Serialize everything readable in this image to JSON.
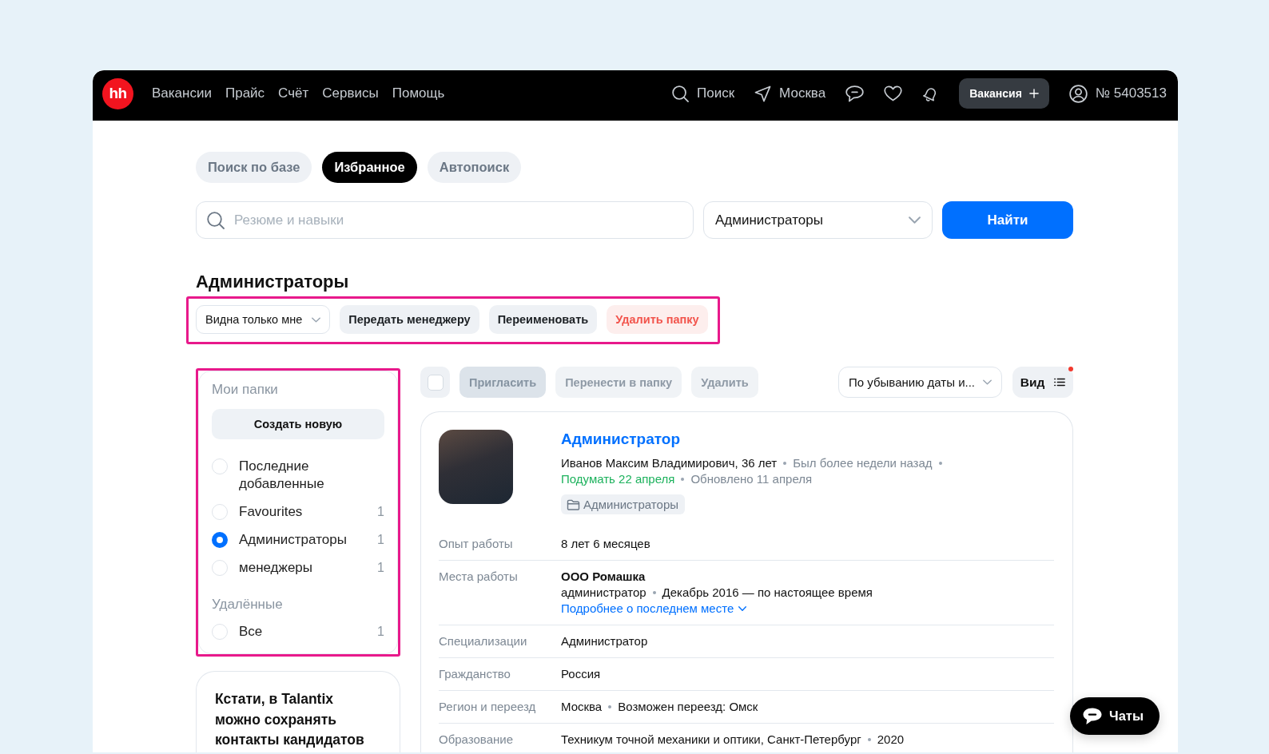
{
  "header": {
    "logo": "hh",
    "nav": [
      "Вакансии",
      "Прайс",
      "Счёт",
      "Сервисы",
      "Помощь"
    ],
    "search": "Поиск",
    "city": "Москва",
    "vacancy_button": "Вакансия",
    "account": "№ 5403513"
  },
  "tabs": [
    {
      "label": "Поиск по базе",
      "selected": false
    },
    {
      "label": "Избранное",
      "selected": true
    },
    {
      "label": "Автопоиск",
      "selected": false
    }
  ],
  "search": {
    "placeholder": "Резюме и навыки"
  },
  "folder_select": {
    "value": "Администраторы"
  },
  "find_button": "Найти",
  "folder_title": "Администраторы",
  "folder_actions": {
    "highlighted": true,
    "visibility": "Видна только мне",
    "buttons": [
      {
        "label": "Передать менеджеру",
        "kind": "default"
      },
      {
        "label": "Переименовать",
        "kind": "default"
      },
      {
        "label": "Удалить папку",
        "kind": "danger"
      }
    ]
  },
  "sidebar": {
    "highlighted": true,
    "my_folders_title": "Мои папки",
    "create_button": "Создать новую",
    "folders": [
      {
        "label": "Последние добавленные",
        "selected": false
      },
      {
        "label": "Favourites",
        "count": "1",
        "selected": false
      },
      {
        "label": "Администраторы",
        "count": "1",
        "selected": true
      },
      {
        "label": "менеджеры",
        "count": "1",
        "selected": false
      }
    ],
    "deleted_title": "Удалённые",
    "deleted": [
      {
        "label": "Все",
        "count": "1",
        "selected": false
      }
    ]
  },
  "promo": {
    "text": "Кстати, в Talantix можно сохранять контакты кандидатов"
  },
  "results": {
    "select_all": {
      "checked": false
    },
    "actions": [
      {
        "label": "Пригласить",
        "kind": "primary",
        "disabled": true
      },
      {
        "label": "Перенести в папку",
        "kind": "secondary",
        "disabled": true
      },
      {
        "label": "Удалить",
        "kind": "secondary",
        "disabled": true
      }
    ],
    "sort": {
      "value": "По убыванию даты и..."
    },
    "view": {
      "label": "Вид",
      "notification": true
    }
  },
  "resume": {
    "title": "Администратор",
    "meta": [
      {
        "text": "Иванов Максим Владимирович, 36 лет",
        "kind": "name"
      },
      {
        "text": "Был более недели назад",
        "kind": "status"
      },
      {
        "text": "Подумать 22 апреля",
        "kind": "reminder"
      },
      {
        "text": "Обновлено 11 апреля",
        "kind": "status"
      }
    ],
    "folder_tag": "Администраторы",
    "rows": [
      {
        "kind": "plain",
        "label": "Опыт работы",
        "values": [
          "8 лет 6 месяцев"
        ]
      },
      {
        "kind": "work",
        "label": "Места работы",
        "company": "ООО Ромашка",
        "values": [
          "администратор",
          "Декабрь 2016 — по настоящее время"
        ],
        "link": "Подробнее о последнем месте"
      },
      {
        "kind": "plain",
        "label": "Специализации",
        "values": [
          "Администратор"
        ]
      },
      {
        "kind": "plain",
        "label": "Гражданство",
        "values": [
          "Россия"
        ]
      },
      {
        "kind": "plain",
        "label": "Регион и переезд",
        "values": [
          "Москва",
          "Возможен переезд: Омск"
        ]
      },
      {
        "kind": "plain",
        "label": "Образование",
        "values": [
          "Техникум точной механики и оптики, Санкт-Петербург",
          "2020"
        ]
      }
    ]
  },
  "chat_button": "Чаты"
}
